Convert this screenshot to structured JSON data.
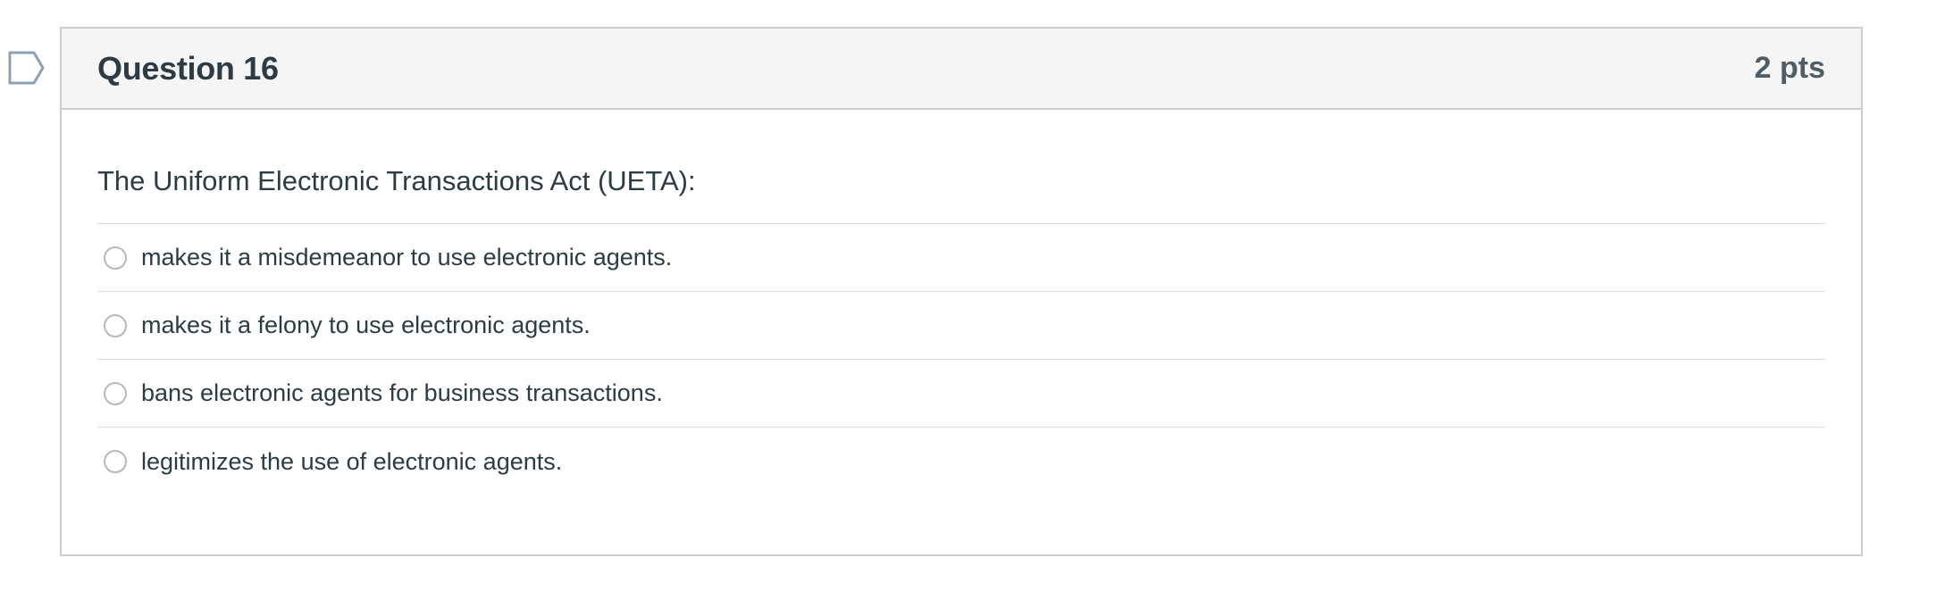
{
  "question": {
    "flag_icon": "flag-outline-icon",
    "title": "Question 16",
    "points": "2 pts",
    "text": "The Uniform Electronic Transactions Act (UETA):",
    "answers": [
      {
        "label": "makes it a misdemeanor to use electronic agents."
      },
      {
        "label": "makes it a felony to use electronic agents."
      },
      {
        "label": "bans electronic agents for business transactions."
      },
      {
        "label": "legitimizes the use of electronic agents."
      }
    ]
  },
  "colors": {
    "border": "#c7cdd1",
    "header_bg": "#f5f5f5",
    "text": "#2d3b45",
    "flag": "#8da0b3"
  }
}
